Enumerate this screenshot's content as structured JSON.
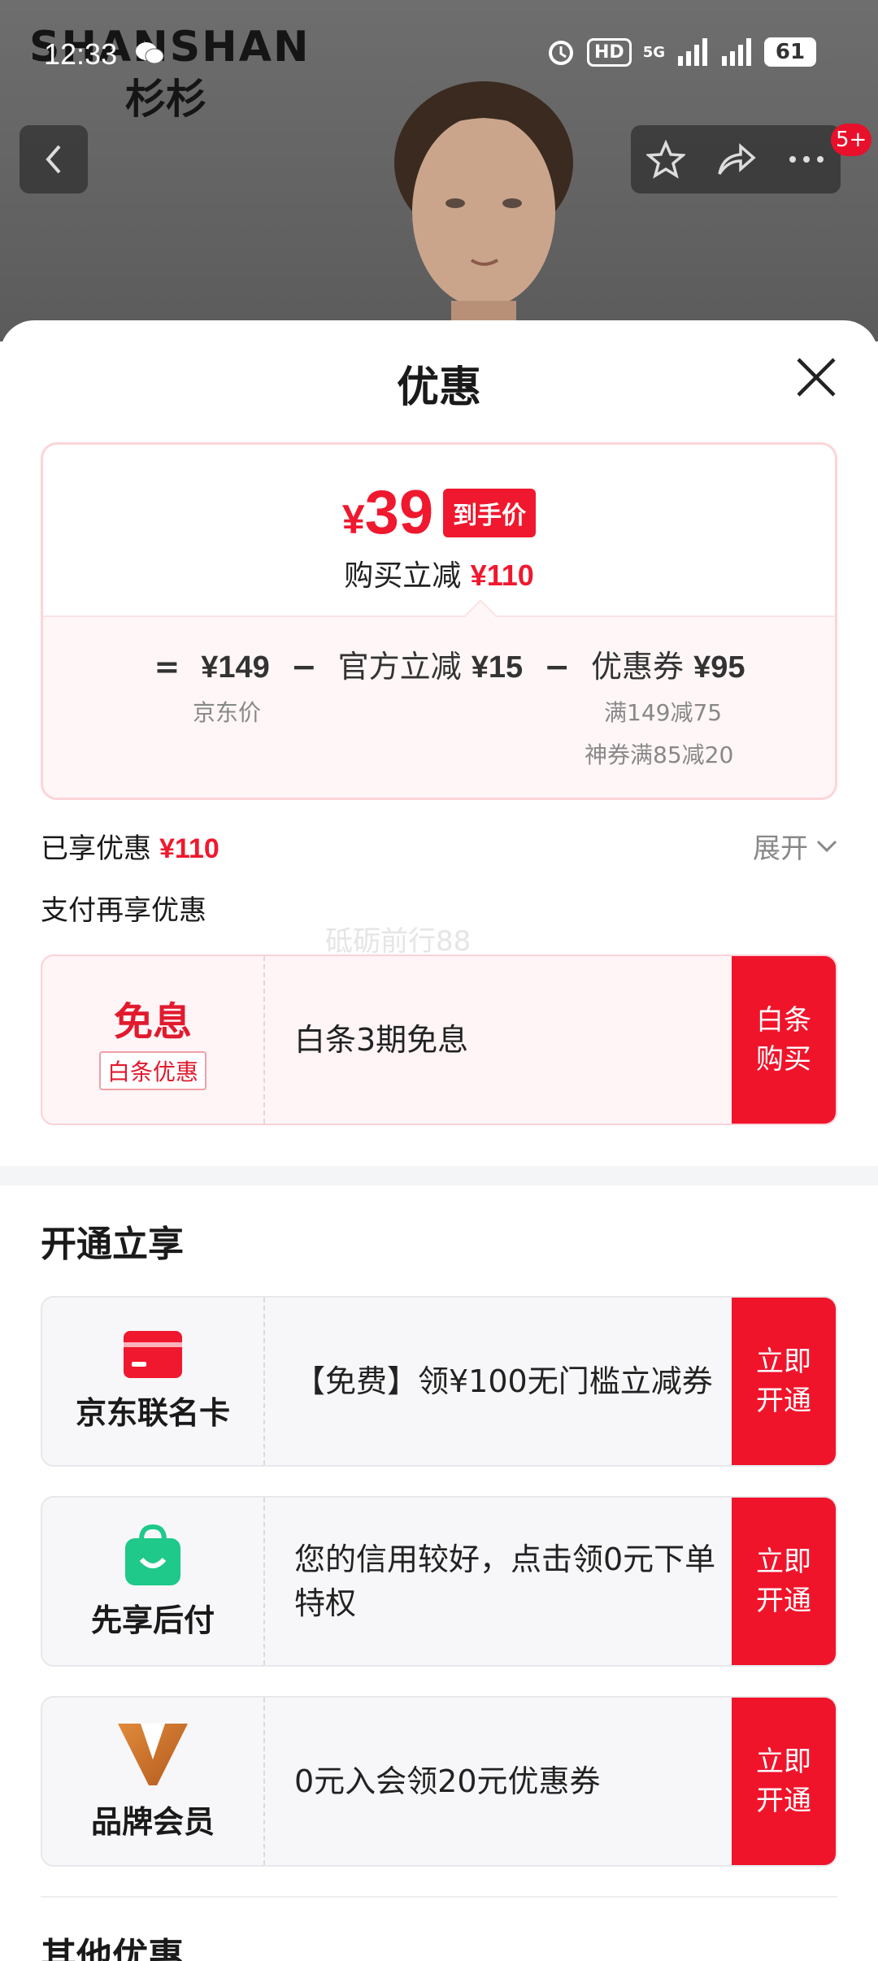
{
  "status": {
    "time": "12:33",
    "battery": "61",
    "network": "5G"
  },
  "brand": {
    "en": "SHANSHAN",
    "cn": "杉杉"
  },
  "nav": {
    "badge": "5+"
  },
  "sheet": {
    "title": "优惠",
    "price": {
      "currency": "¥",
      "amount": "39",
      "tag": "到手价",
      "save_label": "购买立减",
      "save_value": "¥110"
    },
    "formula": {
      "eq": "=",
      "base_value": "¥149",
      "base_label": "京东价",
      "minus": "−",
      "official_label": "官方立减",
      "official_value": "¥15",
      "coupon_label": "优惠券",
      "coupon_value": "¥95",
      "coupon_note1": "满149减75",
      "coupon_note2": "神券满85减20"
    },
    "enjoyed": {
      "label": "已享优惠",
      "value": "¥110",
      "expand": "展开"
    },
    "pay_label": "支付再享优惠",
    "watermark": "砥砺前行88",
    "baitiao": {
      "title": "免息",
      "tag": "白条优惠",
      "desc": "白条3期免息",
      "button_line1": "白条",
      "button_line2": "购买"
    },
    "open_section": "开通立享",
    "offers": [
      {
        "name": "京东联名卡",
        "desc": "【免费】领¥100无门槛立减券",
        "button_line1": "立即",
        "button_line2": "开通"
      },
      {
        "name": "先享后付",
        "desc": "您的信用较好，点击领0元下单特权",
        "button_line1": "立即",
        "button_line2": "开通"
      },
      {
        "name": "品牌会员",
        "desc": "0元入会领20元优惠券",
        "button_line1": "立即",
        "button_line2": "开通"
      }
    ],
    "other_section": "其他优惠"
  },
  "colors": {
    "accent": "#f0182e",
    "card_bg": "#f7f7f9",
    "pink_bg": "#fff4f6"
  }
}
